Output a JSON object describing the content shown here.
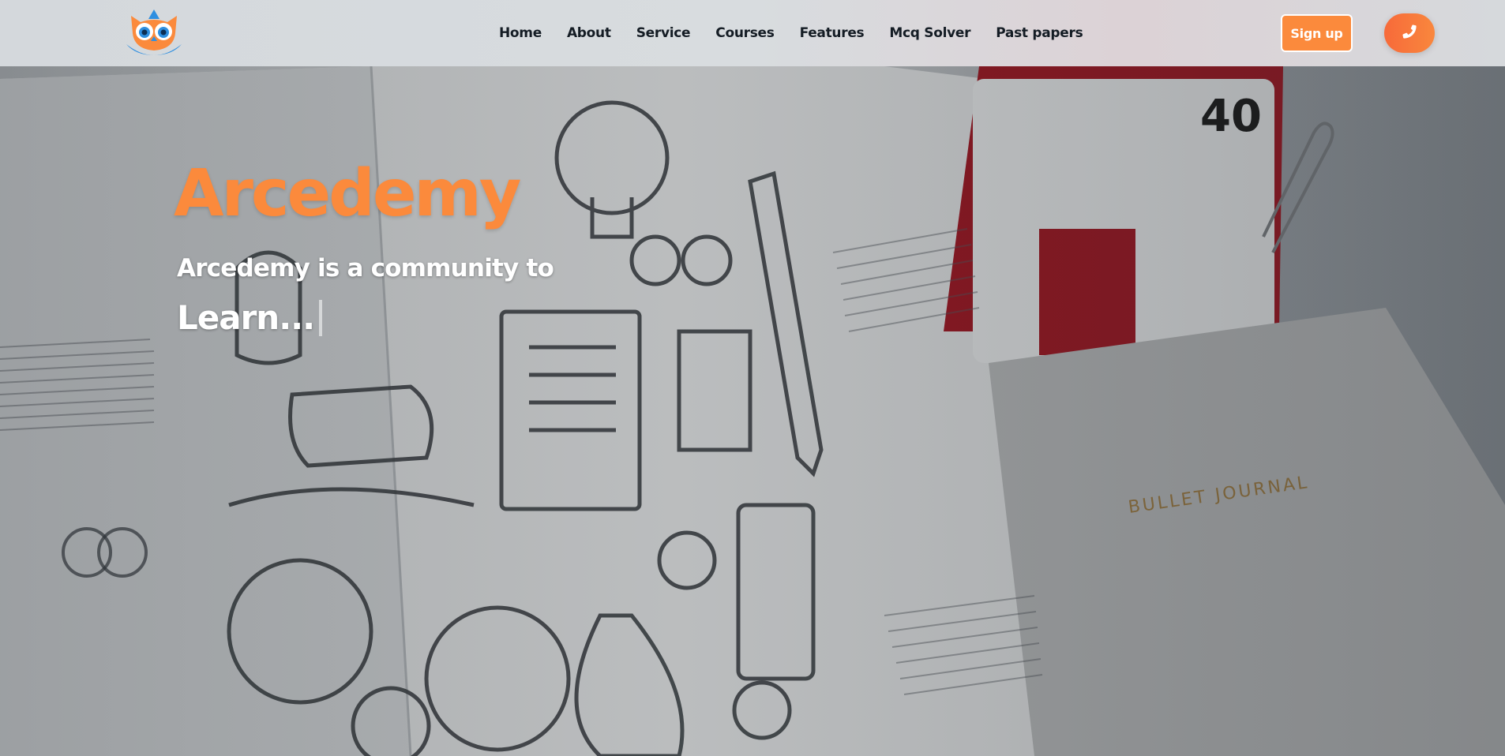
{
  "brand": {
    "logo_icon": "owl-logo-icon",
    "colors": {
      "accent": "#fb8a3c",
      "logo_blue": "#2f8fe0",
      "nav_text": "#141c24"
    }
  },
  "nav": {
    "items": [
      {
        "label": "Home"
      },
      {
        "label": "About"
      },
      {
        "label": "Service"
      },
      {
        "label": "Courses"
      },
      {
        "label": "Features"
      },
      {
        "label": "Mcq Solver"
      },
      {
        "label": "Past papers"
      }
    ],
    "signup_label": "Sign up",
    "phone_icon": "phone-icon"
  },
  "hero": {
    "title": "Arcedemy",
    "subtitle": "Arcedemy is a community to",
    "typed_text": "Learn..."
  }
}
